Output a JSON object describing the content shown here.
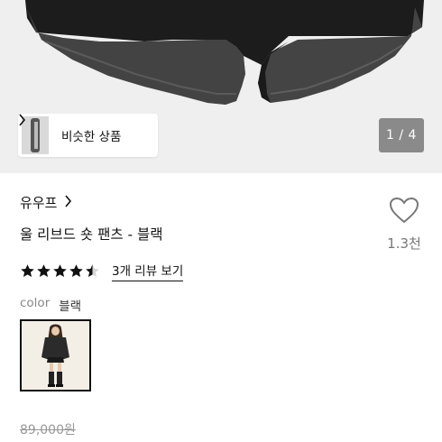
{
  "hero": {
    "similar_button_label": "비슷한 상품",
    "pager_text": "1 / 4"
  },
  "product": {
    "brand": "유우프",
    "title": "울 리브드 숏 팬츠 - 블랙",
    "like_count": "1.3천",
    "rating": 4.5,
    "review_link": "3개 리뷰 보기",
    "color_label": "color",
    "color_value": "블랙",
    "original_price": "89,000원"
  },
  "colors": {
    "accent": "#111111",
    "muted": "#888888",
    "pager_bg": "#8a8a8a",
    "hero_bg": "#efefef"
  },
  "icons": {
    "chevron": "chevron-right-icon",
    "heart": "heart-outline-icon",
    "star": "star-icon"
  }
}
